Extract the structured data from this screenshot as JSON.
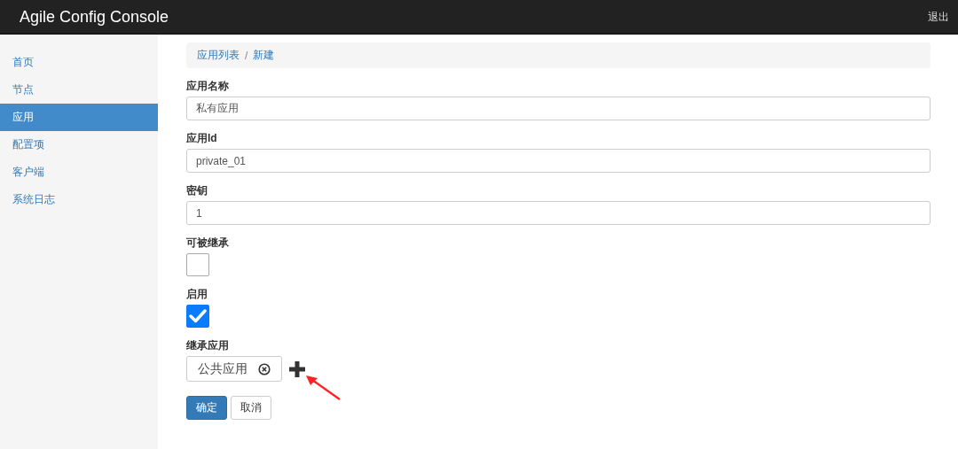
{
  "header": {
    "title": "Agile Config Console",
    "logout": "退出"
  },
  "sidebar": {
    "items": [
      {
        "label": "首页",
        "selected": false
      },
      {
        "label": "节点",
        "selected": false
      },
      {
        "label": "应用",
        "selected": true
      },
      {
        "label": "配置项",
        "selected": false
      },
      {
        "label": "客户端",
        "selected": false
      },
      {
        "label": "系统日志",
        "selected": false
      }
    ]
  },
  "breadcrumb": {
    "items": [
      "应用列表",
      "新建"
    ],
    "separator": "/"
  },
  "form": {
    "fields": [
      {
        "kind": "text",
        "label": "应用名称",
        "value": "私有应用"
      },
      {
        "kind": "text",
        "label": "应用Id",
        "value": "private_01"
      },
      {
        "kind": "text",
        "label": "密钥",
        "value": "1"
      },
      {
        "kind": "checkbox",
        "label": "可被继承",
        "checked": false
      },
      {
        "kind": "checkbox",
        "label": "启用",
        "checked": true
      },
      {
        "kind": "tags",
        "label": "继承应用",
        "tags": [
          "公共应用"
        ]
      }
    ],
    "buttons": [
      {
        "label": "确定",
        "primary": true
      },
      {
        "label": "取消",
        "primary": false
      }
    ]
  }
}
